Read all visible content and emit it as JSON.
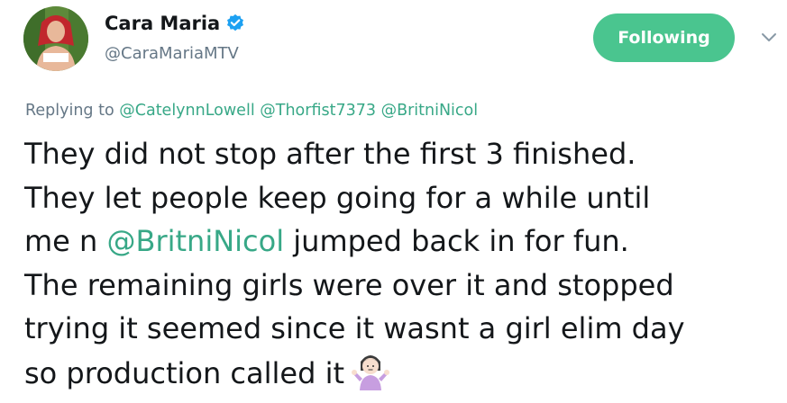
{
  "author": {
    "name": "Cara Maria",
    "handle": "@CaraMariaMTV",
    "avatar_icon": "profile-photo",
    "verified_icon": "verified-badge-icon"
  },
  "follow_button": {
    "label": "Following",
    "color": "#4ac58f"
  },
  "menu_icon": "chevron-down-icon",
  "reply": {
    "prefix": "Replying to",
    "mentions": [
      "@CatelynnLowell",
      "@Thorfist7373",
      "@BritniNicol"
    ]
  },
  "tweet": {
    "lines": [
      "They did not stop after the first 3 finished.",
      "They let people keep going for a while until",
      "jumped back in for fun.",
      "The remaining girls were over it and stopped",
      "trying it seemed since it wasnt a girl elim day",
      "so production called it"
    ],
    "line3_prefix": "me n",
    "line3_mention": "@BritniNicol",
    "emoji_icon": "person-shrugging-emoji"
  },
  "colors": {
    "mention": "#38a887",
    "secondary_text": "#657786",
    "verified": "#1da1f2"
  }
}
